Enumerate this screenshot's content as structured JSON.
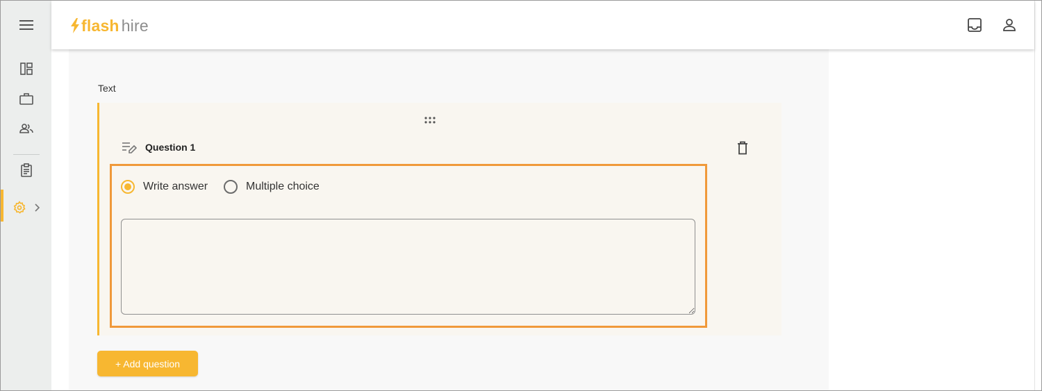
{
  "app": {
    "brand_flash": "flash",
    "brand_hire": "hire"
  },
  "colors": {
    "accent": "#f7b731",
    "highlight": "#f0993a",
    "sidebar_bg": "#eceeed",
    "card_bg": "#f9f6f0"
  },
  "sidebar": {
    "items": [
      {
        "icon": "menu-icon"
      },
      {
        "icon": "dashboard-icon"
      },
      {
        "icon": "briefcase-icon"
      },
      {
        "icon": "people-icon"
      },
      {
        "icon": "clipboard-icon"
      },
      {
        "icon": "settings-icon",
        "active": true,
        "has_submenu": true
      }
    ]
  },
  "header": {
    "icons": [
      "inbox-icon",
      "account-icon"
    ]
  },
  "main": {
    "section_label": "Text",
    "question": {
      "title": "Question 1",
      "options": [
        {
          "label": "Write answer",
          "selected": true
        },
        {
          "label": "Multiple choice",
          "selected": false
        }
      ],
      "answer_value": ""
    },
    "add_question_label": "+ Add question"
  }
}
